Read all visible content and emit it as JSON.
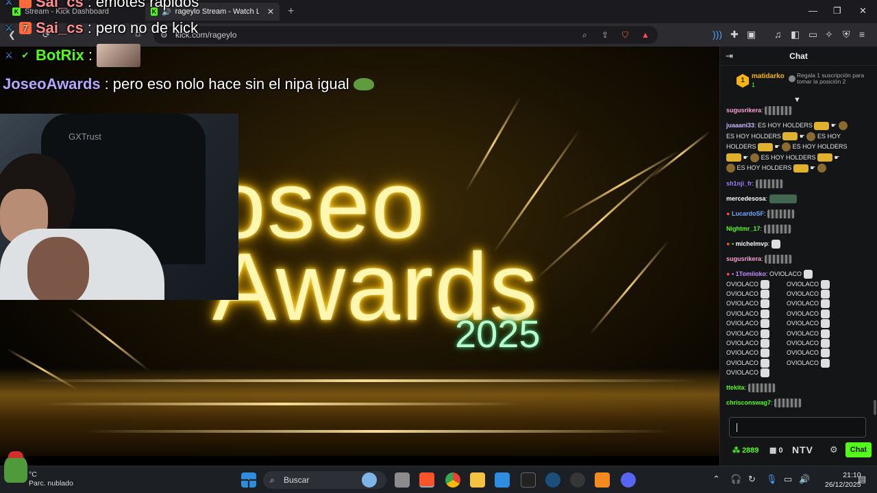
{
  "browser": {
    "tabs": [
      {
        "title": "Stream - Kick Dashboard",
        "active": false
      },
      {
        "title": "rageylo Stream - Watch Live o",
        "active": true
      }
    ],
    "url": "kick.com/rageylo"
  },
  "overlay_chat": [
    {
      "user": "Sai_cs",
      "text": "emotes rapidos",
      "user_color": "#ff8f8f"
    },
    {
      "user": "Sai_cs",
      "text": "pero no de kick",
      "user_color": "#ff8f8f"
    },
    {
      "user": "BotRix",
      "text": "",
      "user_color": "#53fc18"
    },
    {
      "user": "JoseoAwards",
      "text": "pero eso nolo hace sin el nipa igual",
      "user_color": "#b7a7ff"
    }
  ],
  "stream": {
    "title_line1": "oseo",
    "title_line2": "Awards",
    "year": "2025",
    "webcam_brand": "GXTrust"
  },
  "chat": {
    "header": "Chat",
    "pinned": {
      "rank": "1",
      "user": "matidarko",
      "count": "1",
      "text": "Regala 1 suscripción para tomar la posición 2"
    },
    "messages": [
      {
        "user": "sugusrikera",
        "color": "#ff9fd6",
        "text": ""
      },
      {
        "user": "juaaani33",
        "color": "#c9b7ff",
        "text": "ES HOY HOLDERS"
      },
      {
        "user": "",
        "color": "",
        "text": "ES HOY HOLDERS"
      },
      {
        "user": "",
        "color": "",
        "text": "ES HOY"
      },
      {
        "user": "",
        "color": "",
        "text": "HOLDERS"
      },
      {
        "user": "",
        "color": "",
        "text": "ES HOY HOLDERS"
      },
      {
        "user": "",
        "color": "",
        "text": "ES HOY HOLDERS"
      },
      {
        "user": "",
        "color": "",
        "text": "ES HOY HOLDERS"
      },
      {
        "user": "sh1nji_fr",
        "color": "#9f7bff",
        "text": ""
      },
      {
        "user": "mercedesosa",
        "color": "#ffffff",
        "text": ""
      },
      {
        "user": "LucardoSF",
        "color": "#6fa8ff",
        "text": ""
      },
      {
        "user": "Nightmr_17",
        "color": "#53fc18",
        "text": ""
      },
      {
        "user": "michelmvp",
        "color": "#ffffff",
        "text": ""
      },
      {
        "user": "sugusrikera",
        "color": "#ff9fd6",
        "text": ""
      },
      {
        "user": "1Tomiioko",
        "color": "#c38bff",
        "text": "OVIOLACO"
      }
    ],
    "oviolaco_rows": [
      "OVIOLACO",
      "OVIOLACO",
      "OVIOLACO",
      "OVIOLACO",
      "OVIOLACO",
      "OVIOLACO",
      "OVIOLACO",
      "OVIOLACO",
      "OVIOLACO",
      "OVIOLACO",
      "OVIOLACO",
      "OVIOLACO",
      "OVIOLACO",
      "OVIOLACO",
      "OVIOLACO",
      "OVIOLACO",
      "OVIOLACO",
      "OVIOLACO",
      "OVIOLACO"
    ],
    "tail": [
      {
        "user": "ttekita",
        "color": "#53fc18"
      },
      {
        "user": "chrisconswag7",
        "color": "#53fc18"
      }
    ],
    "points": "2889",
    "gifts": "0",
    "ntv": "NTV",
    "send_label": "Chat"
  },
  "taskbar": {
    "temp": "°C",
    "weather": "Parc. nublado",
    "search": "Buscar",
    "time": "21:10",
    "date": "26/12/2025"
  },
  "colors": {
    "kick_green": "#53fc18",
    "gold": "#f5b50b"
  }
}
